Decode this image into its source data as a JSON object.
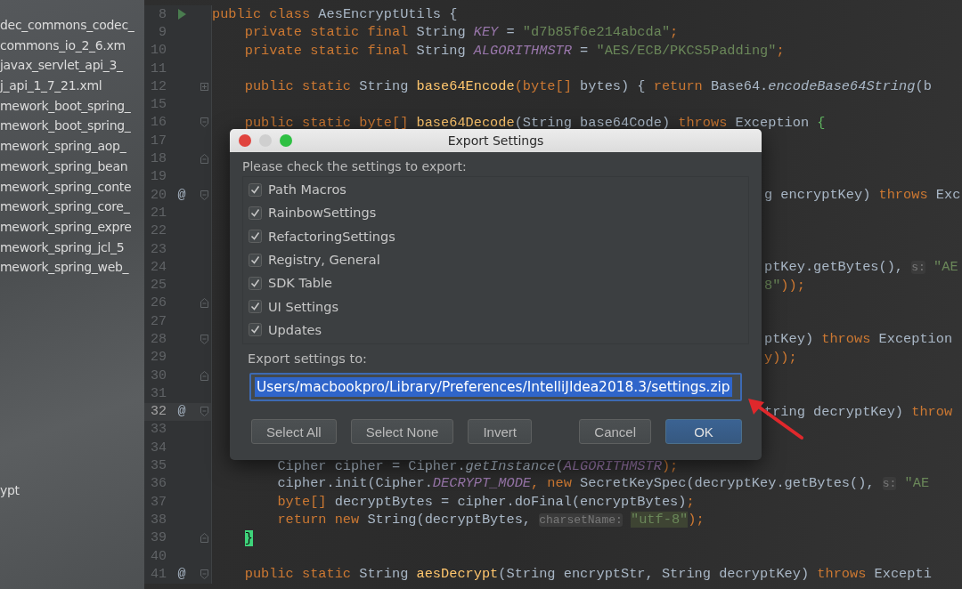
{
  "sidebar": {
    "items": [
      "dec_commons_codec_",
      "commons_io_2_6.xm",
      "javax_servlet_api_3_",
      "j_api_1_7_21.xml",
      "mework_boot_spring_",
      "mework_boot_spring_",
      "mework_spring_aop_",
      "mework_spring_bean",
      "mework_spring_conte",
      "mework_spring_core_",
      "mework_spring_expre",
      "mework_spring_jcl_5",
      "mework_spring_web_"
    ],
    "lower_items": [
      "ypt"
    ]
  },
  "editor": {
    "lines": [
      {
        "number": "8",
        "current": false,
        "kind": "code",
        "gutter_icon": {
          "kind": "run"
        },
        "tokens": [
          {
            "text": "public class ",
            "kind": "keyword"
          },
          {
            "text": "AesEncryptUtils",
            "kind": "plain"
          },
          {
            "text": " {",
            "kind": "plain"
          }
        ]
      },
      {
        "number": "9",
        "current": false,
        "kind": "code",
        "tokens": [
          {
            "text": "    private static final ",
            "kind": "keyword"
          },
          {
            "text": "String ",
            "kind": "plain"
          },
          {
            "text": "KEY",
            "kind": "constant"
          },
          {
            "text": " = ",
            "kind": "plain"
          },
          {
            "text": "\"d7b85f6e214abcda\"",
            "kind": "string"
          },
          {
            "text": ";",
            "kind": "keyword"
          }
        ]
      },
      {
        "number": "10",
        "current": false,
        "kind": "code",
        "tokens": [
          {
            "text": "    private static final ",
            "kind": "keyword"
          },
          {
            "text": "String ",
            "kind": "plain"
          },
          {
            "text": "ALGORITHMSTR",
            "kind": "constant"
          },
          {
            "text": " = ",
            "kind": "plain"
          },
          {
            "text": "\"AES/ECB/PKCS5Padding\"",
            "kind": "string"
          },
          {
            "text": ";",
            "kind": "keyword"
          }
        ]
      },
      {
        "number": "11",
        "current": false
      },
      {
        "number": "12",
        "current": false,
        "kind": "code",
        "fold": {
          "kind": "collapsed"
        },
        "tokens": [
          {
            "text": "    public static ",
            "kind": "keyword"
          },
          {
            "text": "String ",
            "kind": "plain"
          },
          {
            "text": "base64Encode",
            "kind": "method"
          },
          {
            "text": "(byte[]",
            "kind": "keyword"
          },
          {
            "text": " bytes) { ",
            "kind": "plain"
          },
          {
            "text": "return ",
            "kind": "keyword"
          },
          {
            "text": "Base64.",
            "kind": "plain"
          },
          {
            "text": "encodeBase64String",
            "kind": "static-call"
          },
          {
            "text": "(b",
            "kind": "plain"
          }
        ]
      },
      {
        "number": "15",
        "current": false
      },
      {
        "number": "16",
        "current": false,
        "kind": "code",
        "fold": {
          "kind": "start"
        },
        "tokens": [
          {
            "text": "    public static ",
            "kind": "keyword"
          },
          {
            "text": "byte[] ",
            "kind": "keyword"
          },
          {
            "text": "base64Decode",
            "kind": "method"
          },
          {
            "text": "(String base64Code) ",
            "kind": "plain"
          },
          {
            "text": "throws ",
            "kind": "keyword"
          },
          {
            "text": "Exception ",
            "kind": "plain"
          },
          {
            "text": "{",
            "kind": "brace"
          }
        ]
      },
      {
        "number": "17",
        "current": false
      },
      {
        "number": "18",
        "current": false,
        "fold": {
          "kind": "end"
        }
      },
      {
        "number": "19",
        "current": false
      },
      {
        "number": "20",
        "current": false,
        "kind": "behind-dialog",
        "annotation": "@",
        "fold": {
          "kind": "start"
        },
        "tokens": [
          {
            "text": "g encryptKey) ",
            "kind": "plain"
          },
          {
            "text": "throws ",
            "kind": "keyword"
          },
          {
            "text": "Exc",
            "kind": "plain"
          }
        ]
      },
      {
        "number": "21",
        "current": false
      },
      {
        "number": "22",
        "current": false
      },
      {
        "number": "23",
        "current": false
      },
      {
        "number": "24",
        "current": false,
        "kind": "behind-dialog",
        "tokens": [
          {
            "text": "ptKey.getBytes(), ",
            "kind": "plain"
          },
          {
            "text": "s:",
            "kind": "hint"
          },
          {
            "text": " \"AE",
            "kind": "string"
          }
        ]
      },
      {
        "number": "25",
        "current": false,
        "kind": "behind-dialog",
        "tokens": [
          {
            "text": "8\"",
            "kind": "string"
          },
          {
            "text": "));",
            "kind": "keyword"
          }
        ]
      },
      {
        "number": "26",
        "current": false,
        "fold": {
          "kind": "end"
        }
      },
      {
        "number": "27",
        "current": false
      },
      {
        "number": "28",
        "current": false,
        "kind": "behind-dialog",
        "fold": {
          "kind": "start"
        },
        "tokens": [
          {
            "text": "ptKey) ",
            "kind": "plain"
          },
          {
            "text": "throws ",
            "kind": "keyword"
          },
          {
            "text": "Exception",
            "kind": "plain"
          }
        ]
      },
      {
        "number": "29",
        "current": false,
        "kind": "behind-dialog",
        "tokens": [
          {
            "text": "y));",
            "kind": "keyword"
          }
        ]
      },
      {
        "number": "30",
        "current": false,
        "fold": {
          "kind": "end"
        }
      },
      {
        "number": "31",
        "current": false
      },
      {
        "number": "32",
        "current": true,
        "kind": "behind-dialog",
        "annotation": "@",
        "fold": {
          "kind": "start"
        },
        "tokens": [
          {
            "text": "tring decryptKey) ",
            "kind": "plain"
          },
          {
            "text": "throw",
            "kind": "keyword"
          }
        ]
      },
      {
        "number": "33",
        "current": false
      },
      {
        "number": "34",
        "current": false
      },
      {
        "number": "35",
        "current": false,
        "kind": "code",
        "tokens": [
          {
            "text": "        Cipher cipher = Cipher.",
            "kind": "plain"
          },
          {
            "text": "getInstance",
            "kind": "static-call"
          },
          {
            "text": "(",
            "kind": "plain"
          },
          {
            "text": "ALGORITHMSTR",
            "kind": "constant"
          },
          {
            "text": ");",
            "kind": "keyword"
          }
        ]
      },
      {
        "number": "36",
        "current": false,
        "kind": "code",
        "tokens": [
          {
            "text": "        cipher.init(Cipher.",
            "kind": "plain"
          },
          {
            "text": "DECRYPT_MODE",
            "kind": "constant"
          },
          {
            "text": ", new ",
            "kind": "keyword"
          },
          {
            "text": "SecretKeySpec(decryptKey.getBytes(), ",
            "kind": "plain"
          },
          {
            "text": "s:",
            "kind": "hint"
          },
          {
            "text": " \"AE",
            "kind": "string"
          }
        ]
      },
      {
        "number": "37",
        "current": false,
        "kind": "code",
        "tokens": [
          {
            "text": "        byte[] ",
            "kind": "keyword"
          },
          {
            "text": "decryptBytes = cipher.doFinal(encryptBytes)",
            "kind": "plain"
          },
          {
            "text": ";",
            "kind": "keyword"
          }
        ]
      },
      {
        "number": "38",
        "current": false,
        "kind": "code",
        "tokens": [
          {
            "text": "        return new ",
            "kind": "keyword"
          },
          {
            "text": "String(decryptBytes, ",
            "kind": "plain"
          },
          {
            "text": "charsetName:",
            "kind": "hint"
          },
          {
            "text": "\"utf-8\"",
            "kind": "string-match"
          },
          {
            "text": ");",
            "kind": "keyword"
          }
        ]
      },
      {
        "number": "39",
        "current": false,
        "kind": "code",
        "fold": {
          "kind": "end"
        },
        "tokens": [
          {
            "text": "}",
            "kind": "brace-match"
          }
        ]
      },
      {
        "number": "40",
        "current": false
      },
      {
        "number": "41",
        "current": false,
        "kind": "code",
        "annotation": "@",
        "fold": {
          "kind": "start"
        },
        "tokens": [
          {
            "text": "    public static ",
            "kind": "keyword"
          },
          {
            "text": "String ",
            "kind": "plain"
          },
          {
            "text": "aesDecrypt",
            "kind": "method"
          },
          {
            "text": "(String encryptStr, String decryptKey) ",
            "kind": "plain"
          },
          {
            "text": "throws ",
            "kind": "keyword"
          },
          {
            "text": "Excepti",
            "kind": "plain"
          }
        ]
      }
    ]
  },
  "dialog": {
    "title": "Export Settings",
    "prompt": "Please check the settings to export:",
    "options": [
      {
        "label": "Path Macros",
        "checked": true
      },
      {
        "label": "RainbowSettings",
        "checked": true
      },
      {
        "label": "RefactoringSettings",
        "checked": true
      },
      {
        "label": "Registry, General",
        "checked": true
      },
      {
        "label": "SDK Table",
        "checked": true
      },
      {
        "label": "UI Settings",
        "checked": true
      },
      {
        "label": "Updates",
        "checked": true
      }
    ],
    "path_label": "Export settings to:",
    "path_field": {
      "value": "Users/macbookpro/Library/Preferences/IntelliJIdea2018.3/settings.zip",
      "text_selected": true
    },
    "buttons": [
      {
        "label": "Select All",
        "kind": "selection",
        "default": false
      },
      {
        "label": "Select None",
        "kind": "selection",
        "default": false
      },
      {
        "label": "Invert",
        "kind": "selection",
        "default": false
      },
      {
        "label": "Cancel",
        "kind": "confirm",
        "default": false
      },
      {
        "label": "OK",
        "kind": "confirm",
        "default": true
      }
    ]
  }
}
